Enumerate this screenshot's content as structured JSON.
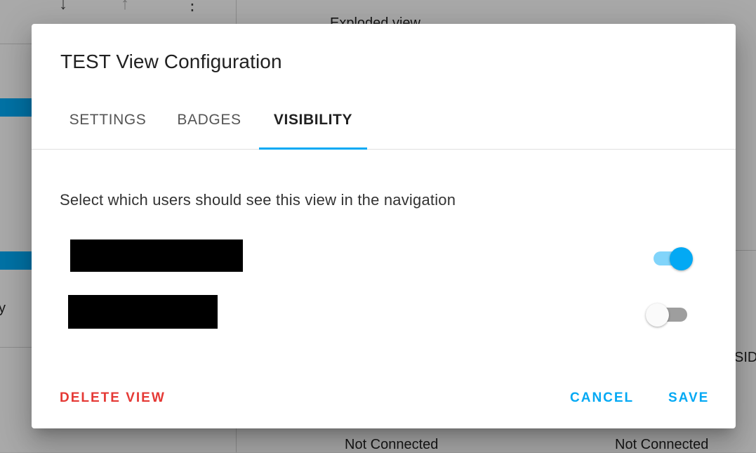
{
  "background": {
    "toolbar_icons": [
      "download-icon",
      "upload-icon",
      "more-vert-icon"
    ],
    "partial_heading": "Exploded view",
    "right_edge_text": "SID",
    "status_left": "Not Connected",
    "status_right": "Not Connected",
    "side_letter": "y"
  },
  "dialog": {
    "title": "TEST View Configuration",
    "tabs": [
      {
        "label": "SETTINGS",
        "active": false
      },
      {
        "label": "BADGES",
        "active": false
      },
      {
        "label": "VISIBILITY",
        "active": true
      }
    ],
    "description": "Select which users should see this view in the navigation",
    "users": [
      {
        "name": "",
        "redacted": true,
        "visible": true
      },
      {
        "name": "",
        "redacted": true,
        "visible": false
      }
    ],
    "actions": {
      "delete_label": "DELETE VIEW",
      "cancel_label": "CANCEL",
      "save_label": "SAVE"
    }
  },
  "colors": {
    "accent": "#03a9f4",
    "accent_light": "#81d4fa",
    "danger": "#e53935",
    "toggle_off_track": "#9e9e9e",
    "toggle_off_thumb": "#fafafa"
  }
}
